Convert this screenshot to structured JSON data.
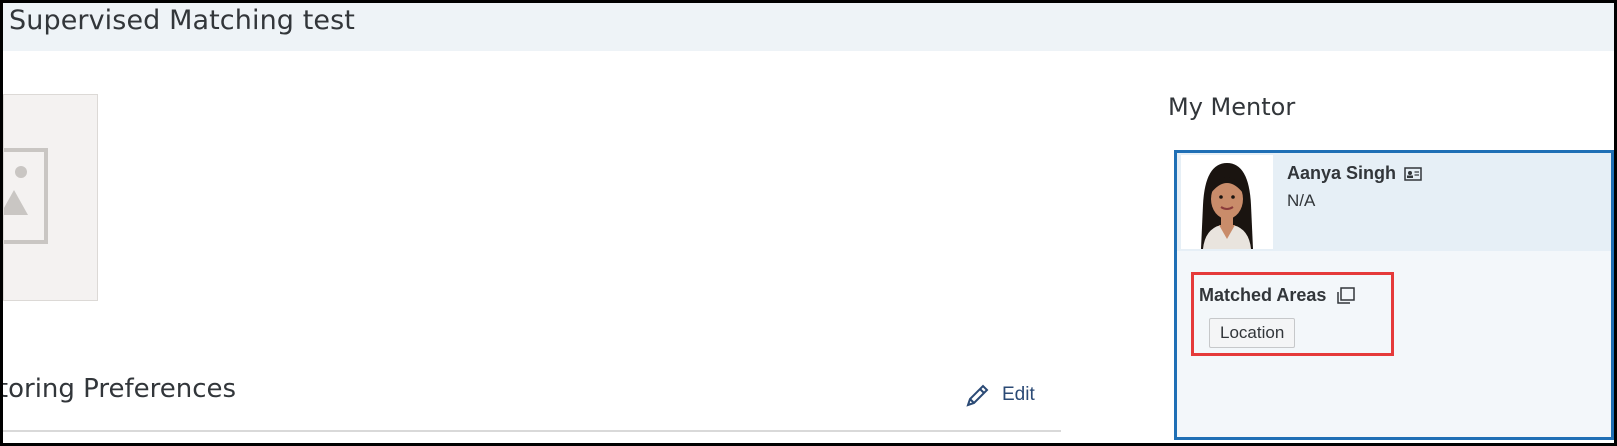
{
  "header": {
    "title": "Supervised Matching test"
  },
  "main": {
    "section_title": "Mentoring Preferences",
    "edit_label": "Edit"
  },
  "mentor_panel": {
    "title": "My Mentor",
    "mentor": {
      "name": "Aanya Singh",
      "subtitle": "N/A"
    },
    "matched_areas": {
      "label": "Matched Areas",
      "tags": [
        "Location"
      ]
    }
  },
  "colors": {
    "header_bg": "#eef3f7",
    "accent": "#1f6fb5",
    "highlight": "#e53a3a"
  }
}
